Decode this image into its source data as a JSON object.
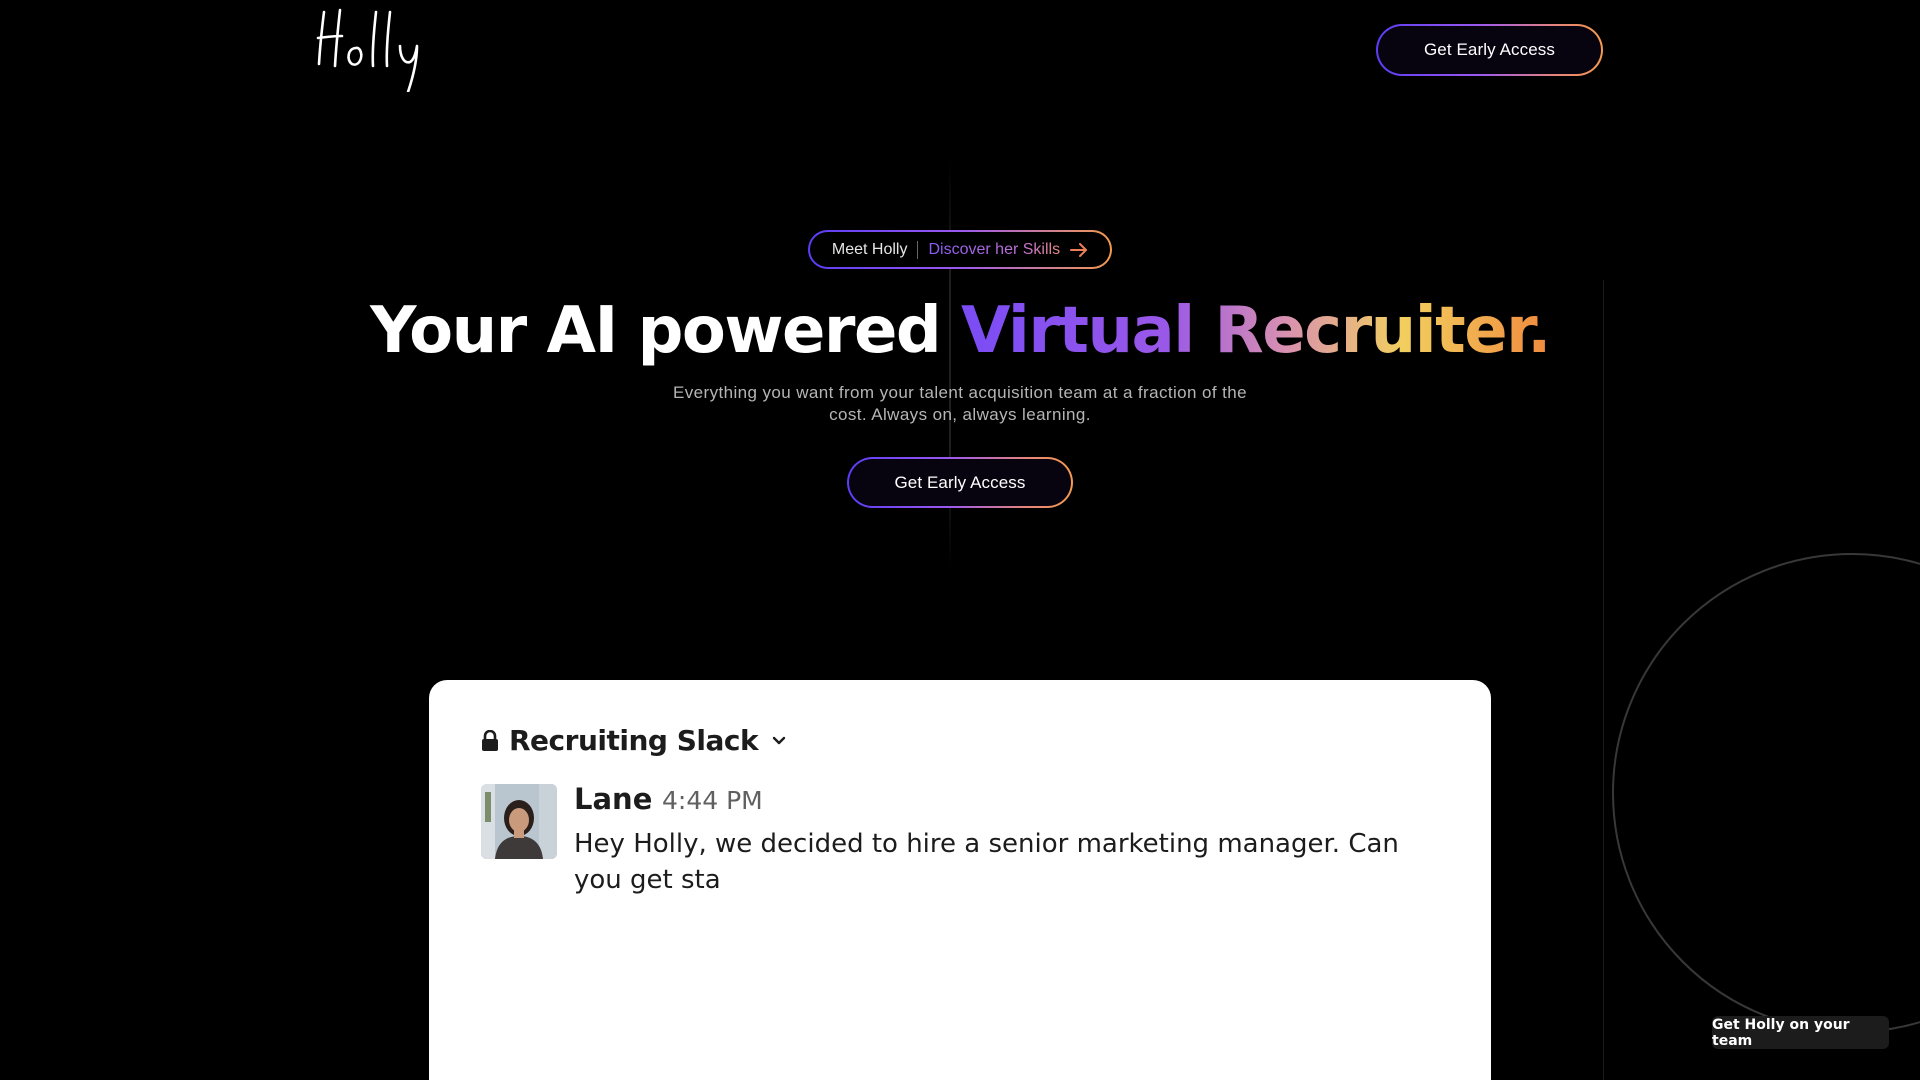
{
  "header": {
    "logo_text": "Holly",
    "cta_label": "Get Early Access"
  },
  "pill": {
    "meet_label": "Meet Holly",
    "discover_label": "Discover her Skills",
    "arrow_icon": "arrow-right-icon"
  },
  "hero": {
    "headline_plain": "Your AI powered ",
    "headline_gradient": "Virtual Recruiter.",
    "subtitle": "Everything you want from your talent acquisition team at a fraction of the cost. Always on, always learning.",
    "cta_label": "Get Early Access"
  },
  "slack": {
    "channel_icon": "lock-icon",
    "channel_name": "Recruiting Slack",
    "dropdown_icon": "chevron-down-icon",
    "message": {
      "author": "Lane",
      "time": "4:44 PM",
      "text": "Hey Holly, we decided to hire a senior marketing manager. Can you get sta"
    }
  },
  "floating": {
    "label": "Get Holly on your team"
  },
  "colors": {
    "background": "#000000",
    "gradient_start": "#5b3df5",
    "gradient_mid": "#9b59f0",
    "gradient_end": "#f39a4e"
  }
}
